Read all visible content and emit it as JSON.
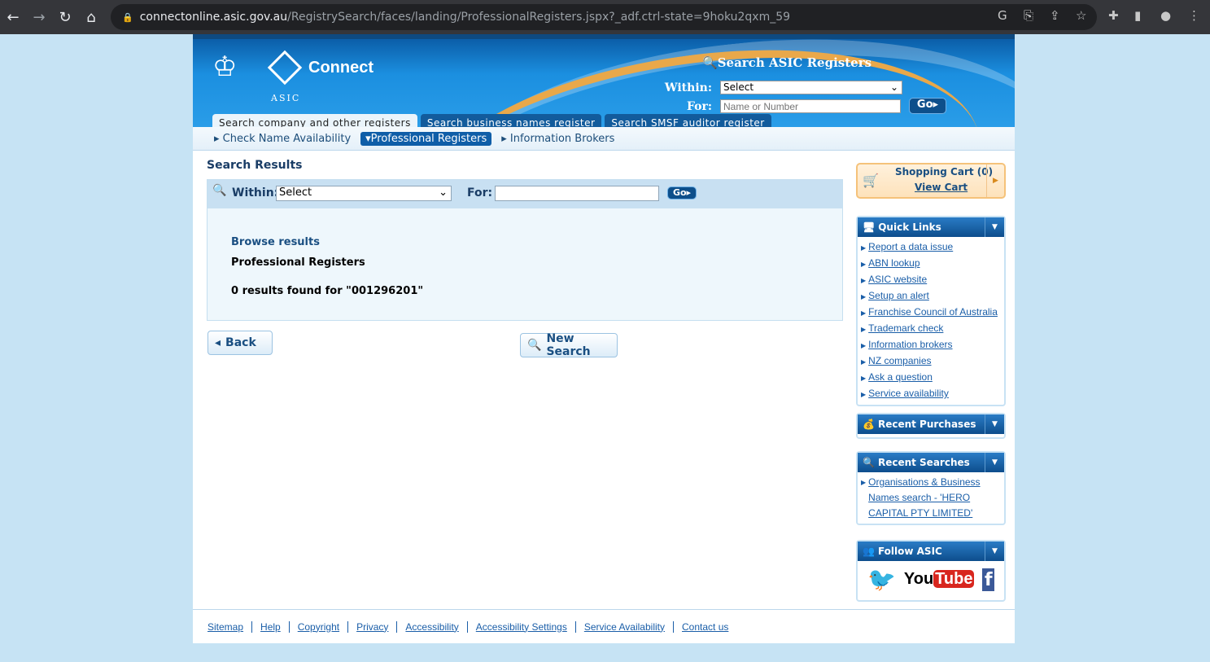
{
  "browser": {
    "url_host": "connectonline.asic.gov.au",
    "url_path": "/RegistrySearch/faces/landing/ProfessionalRegisters.jspx?_adf.ctrl-state=9hoku2qxm_59"
  },
  "header": {
    "brand": "Connect",
    "asic": "ASIC",
    "search_title": "Search ASIC Registers",
    "within_label": "Within:",
    "within_value": "Select",
    "for_label": "For:",
    "for_placeholder": "Name or Number",
    "go": "Go"
  },
  "tabs": [
    "Search company and other registers",
    "Search business names register",
    "Search SMSF auditor register"
  ],
  "subnav": [
    "Check Name Availability",
    "Professional Registers",
    "Information Brokers"
  ],
  "main": {
    "title": "Search Results",
    "within_label": "Within:",
    "within_value": "Select",
    "for_label": "For:",
    "for_value": "",
    "go": "Go",
    "browse": "Browse results",
    "register": "Professional Registers",
    "result": "0 results found for \"001296201\"",
    "back": "Back",
    "new_search": "New Search"
  },
  "cart": {
    "title": "Shopping Cart (0)",
    "view": "View Cart"
  },
  "quick_links": {
    "title": "Quick Links",
    "items": [
      "Report a data issue",
      "ABN lookup",
      "ASIC website",
      "Setup an alert",
      "Franchise Council of Australia",
      "Trademark check",
      "Information brokers",
      "NZ companies",
      "Ask a question",
      "Service availability"
    ]
  },
  "recent_purchases": {
    "title": "Recent Purchases"
  },
  "recent_searches": {
    "title": "Recent Searches",
    "items": [
      "Organisations & Business Names search - 'HERO CAPITAL PTY LIMITED'"
    ]
  },
  "follow": {
    "title": "Follow ASIC",
    "youtube": "YouTube"
  },
  "footer": [
    "Sitemap",
    "Help",
    "Copyright",
    "Privacy",
    "Accessibility",
    "Accessibility Settings",
    "Service Availability",
    "Contact us"
  ]
}
